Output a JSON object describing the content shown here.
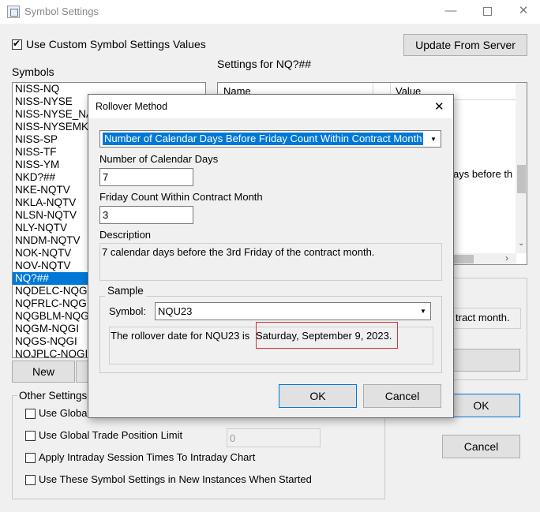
{
  "window": {
    "title": "Symbol Settings",
    "minimize_glyph": "—",
    "close_glyph": "✕"
  },
  "main": {
    "use_custom_label": "Use Custom Symbol Settings Values",
    "use_custom_checked": true,
    "update_button": "Update From Server",
    "symbols_label": "Symbols",
    "settings_for_label": "Settings for NQ?##",
    "symbols": [
      "NISS-NQ",
      "NISS-NYSE",
      "NISS-NYSE_NA",
      "NISS-NYSEMKT",
      "NISS-SP",
      "NISS-TF",
      "NISS-YM",
      "NKD?##",
      "NKE-NQTV",
      "NKLA-NQTV",
      "NLSN-NQTV",
      "NLY-NQTV",
      "NNDM-NQTV",
      "NOK-NQTV",
      "NOV-NQTV",
      "NQ?##",
      "NQDELC-NQGI",
      "NQFRLC-NQGI",
      "NQGBLM-NQGI",
      "NQGM-NQGI",
      "NQGS-NQGI",
      "NQJPLC-NQGI"
    ],
    "selected_symbol": "NQ?##",
    "grid_headers": {
      "name": "Name",
      "value": "Value"
    },
    "grid_partial_text": "ays before th",
    "right_partial_text": "tract month.",
    "new_button": "New",
    "ok_button": "OK",
    "cancel_button": "Cancel",
    "other_settings_label": "Other Settings",
    "options": [
      {
        "label": "Use Globa",
        "checked": false
      },
      {
        "label": "Use Global Trade Position Limit",
        "checked": false
      },
      {
        "label": "Apply Intraday Session Times To Intraday Chart",
        "checked": false
      },
      {
        "label": "Use These Symbol Settings in New Instances When Started",
        "checked": false
      }
    ],
    "position_limit_value": "0"
  },
  "modal": {
    "title": "Rollover Method",
    "method_selected": "Number of Calendar Days Before Friday Count Within Contract Month",
    "calendar_days_label": "Number of Calendar Days",
    "calendar_days_value": "7",
    "friday_count_label": "Friday Count Within Contract Month",
    "friday_count_value": "3",
    "description_label": "Description",
    "description_text": "7 calendar days before the 3rd Friday of the contract month.",
    "sample_label": "Sample",
    "symbol_label": "Symbol:",
    "symbol_value": "NQU23",
    "rollover_prefix": "The rollover date for NQU23 is",
    "rollover_date": "Saturday, September 9, 2023.",
    "ok_button": "OK",
    "cancel_button": "Cancel"
  },
  "colors": {
    "selection": "#0078d7",
    "highlight_border": "#e03030"
  }
}
